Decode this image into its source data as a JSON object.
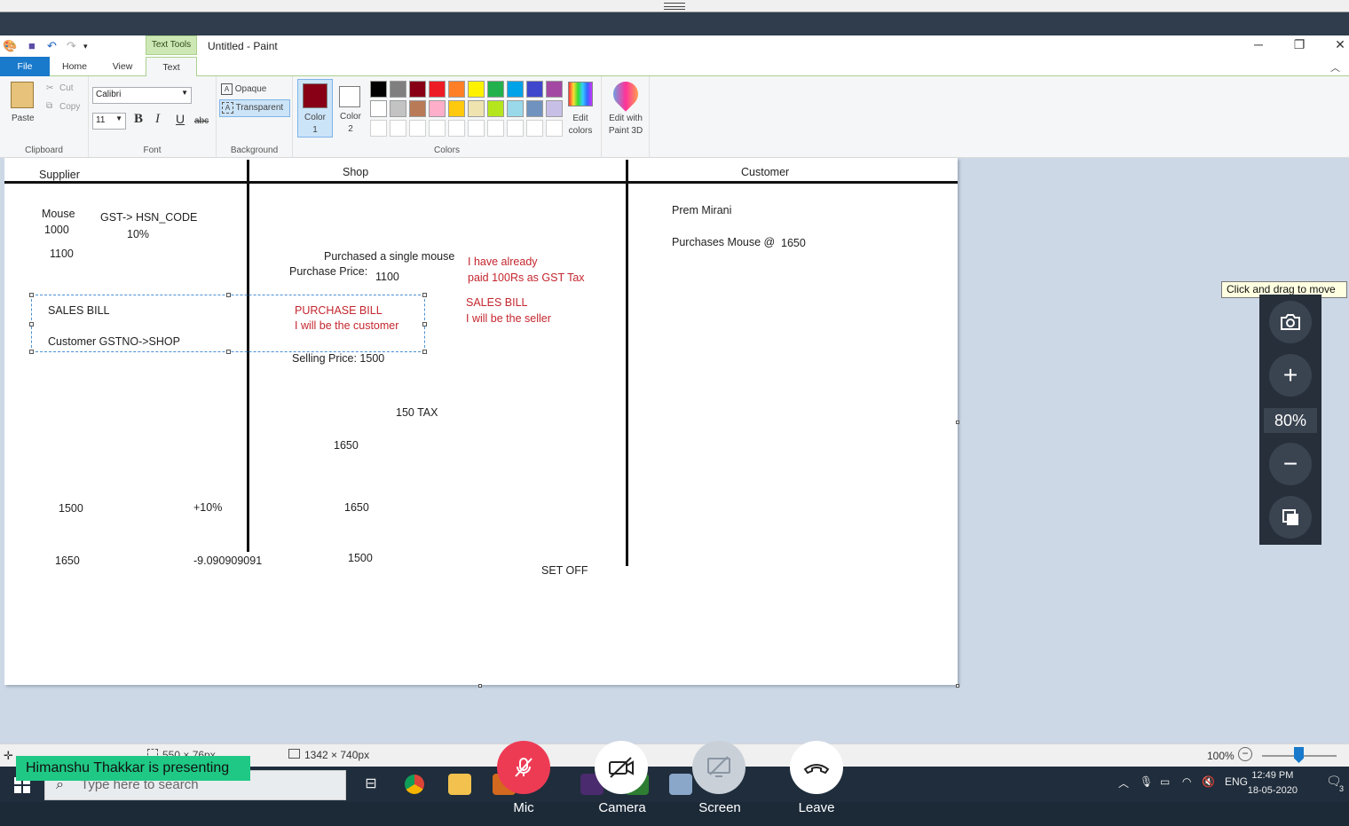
{
  "window": {
    "title": "Untitled - Paint",
    "context_tab": "Text Tools",
    "tabs": [
      "File",
      "Home",
      "View",
      "Text"
    ]
  },
  "ribbon": {
    "clipboard": {
      "paste": "Paste",
      "cut": "Cut",
      "copy": "Copy",
      "label": "Clipboard"
    },
    "font": {
      "family": "Calibri",
      "size": "11",
      "bold": "B",
      "italic": "I",
      "underline": "U",
      "strike": "abc",
      "label": "Font"
    },
    "background": {
      "opaque": "Opaque",
      "transparent": "Transparent",
      "label": "Background"
    },
    "colors": {
      "color1_label": "Color\n1",
      "color1_line1": "Color",
      "color1_line2": "1",
      "color2_line1": "Color",
      "color2_line2": "2",
      "color1": "#880015",
      "color2": "#ffffff",
      "palette_row1": [
        "#000000",
        "#7f7f7f",
        "#880015",
        "#ed1c24",
        "#ff7f27",
        "#fff200",
        "#22b14c",
        "#00a2e8",
        "#3f48cc",
        "#a349a4"
      ],
      "palette_row2": [
        "#ffffff",
        "#c3c3c3",
        "#b97a57",
        "#ffaec9",
        "#ffc90e",
        "#efe4b0",
        "#b5e61d",
        "#99d9ea",
        "#7092be",
        "#c8bfe7"
      ],
      "edit_colors_line1": "Edit",
      "edit_colors_line2": "colors",
      "paint3d_line1": "Edit with",
      "paint3d_line2": "Paint 3D",
      "label": "Colors"
    }
  },
  "canvas": {
    "headers": {
      "supplier": "Supplier",
      "shop": "Shop",
      "customer": "Customer"
    },
    "texts": {
      "mouse": "Mouse",
      "v1000": "1000",
      "gst": "GST-> HSN_CODE",
      "pct10": "10%",
      "v1100a": "1100",
      "purchased": "Purchased a single mouse",
      "purchase_price": "Purchase Price:",
      "v1100b": "1100",
      "paid1": "I have already",
      "paid2": "paid 100Rs as GST Tax",
      "sales_bill_left": "SALES BILL",
      "customer_gst": "Customer GSTNO->SHOP",
      "purchase_bill": "PURCHASE BILL",
      "be_customer": "I will be the customer",
      "sales_bill_right": "SALES BILL",
      "be_seller": "I will be the seller",
      "selling_price": "Selling Price: 1500",
      "tax150": "150 TAX",
      "v1650a": "1650",
      "v1500a": "1500",
      "plus10": "+10%",
      "v1650b": "1650",
      "v1650c": "1650",
      "neg9": "-9.090909091",
      "v1500b": "1500",
      "setoff": "SET OFF",
      "prem": "Prem Mirani",
      "purchases_mouse": "Purchases Mouse @",
      "v1650d": "1650"
    }
  },
  "statusbar": {
    "selection_size": "550 × 76px",
    "canvas_size": "1342 × 740px",
    "zoom": "100%"
  },
  "taskbar": {
    "search_placeholder": "Type here to search",
    "lang": "ENG",
    "time": "12:49 PM",
    "date": "18-05-2020",
    "notif_count": "3"
  },
  "meeting": {
    "presenting": "Himanshu Thakkar is presenting",
    "mic": "Mic",
    "camera": "Camera",
    "screen": "Screen",
    "leave": "Leave"
  },
  "zoom_panel": {
    "tooltip": "Click and drag to move",
    "value": "80%"
  }
}
